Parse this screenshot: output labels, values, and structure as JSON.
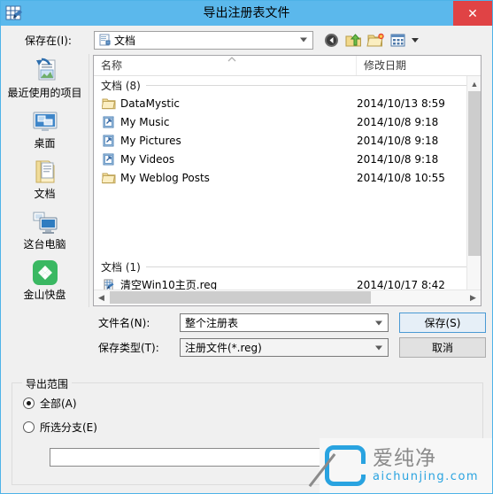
{
  "window": {
    "title": "导出注册表文件",
    "icon": "registry-editor-icon",
    "close_label": "✕",
    "titlebar_color": "#5bb8ec",
    "close_color": "#e04345"
  },
  "savein": {
    "label": "保存在(I):",
    "value": "文档",
    "icon": "document-folder-icon"
  },
  "toolbar": {
    "back": "back-icon",
    "up": "up-folder-icon",
    "new_folder": "new-folder-icon",
    "views": "views-icon",
    "views_arrow": "chevron-down-icon"
  },
  "places": [
    {
      "label": "最近使用的项目",
      "icon": "recent-items-icon"
    },
    {
      "label": "桌面",
      "icon": "desktop-icon"
    },
    {
      "label": "文档",
      "icon": "documents-icon"
    },
    {
      "label": "这台电脑",
      "icon": "this-pc-icon"
    },
    {
      "label": "金山快盘",
      "icon": "kingsoft-kuaipan-icon"
    }
  ],
  "filelist": {
    "columns": [
      "名称",
      "修改日期"
    ],
    "groups": [
      {
        "title": "文档 (8)",
        "rows": [
          {
            "name": "DataMystic",
            "date": "2014/10/13 8:59",
            "icon": "folder-icon"
          },
          {
            "name": "My Music",
            "date": "2014/10/8 9:18",
            "icon": "shortcut-icon"
          },
          {
            "name": "My Pictures",
            "date": "2014/10/8 9:18",
            "icon": "shortcut-icon"
          },
          {
            "name": "My Videos",
            "date": "2014/10/8 9:18",
            "icon": "shortcut-icon"
          },
          {
            "name": "My Weblog Posts",
            "date": "2014/10/8 10:55",
            "icon": "folder-icon"
          }
        ]
      },
      {
        "title": "文档 (1)",
        "rows": [
          {
            "name": "清空Win10主页.reg",
            "date": "2014/10/17 8:42",
            "icon": "reg-file-icon"
          }
        ]
      }
    ],
    "vscroll": {
      "up": "▲",
      "down": "▼"
    },
    "hscroll": {
      "left": "◀",
      "right": "▶"
    }
  },
  "form": {
    "filename_label": "文件名(N):",
    "filename_value": "整个注册表",
    "filetype_label": "保存类型(T):",
    "filetype_value": "注册文件(*.reg)",
    "save_button": "保存(S)",
    "cancel_button": "取消"
  },
  "range": {
    "legend": "导出范围",
    "options": [
      {
        "label": "全部(A)",
        "checked": true
      },
      {
        "label": "所选分支(E)",
        "checked": false
      }
    ],
    "branch_value": ""
  },
  "watermark": {
    "cn": "爱纯净",
    "en": "aichunjing.com",
    "brand_color": "#29a3e0"
  }
}
